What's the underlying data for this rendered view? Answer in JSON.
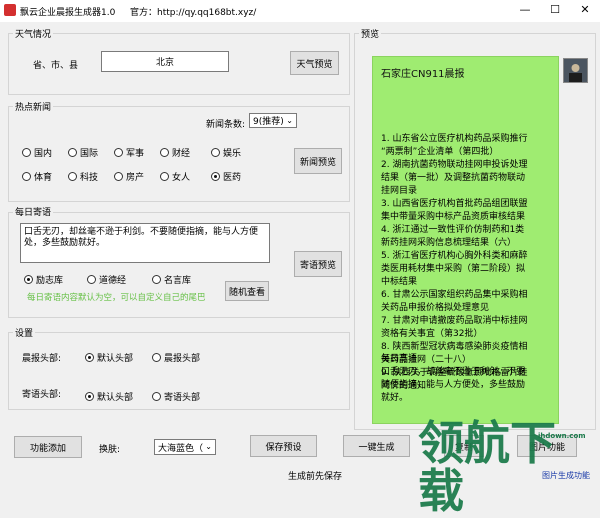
{
  "window": {
    "title": "飘云企业晨报生成器1.0",
    "website": "官方：http://qy.qq168bt.xyz/",
    "controls": [
      "—",
      "☐",
      "✕"
    ]
  },
  "weather": {
    "group_title": "天气情况",
    "label": "省、市、县",
    "value": "北京",
    "preview_button": "天气预览"
  },
  "news": {
    "group_title": "热点新闻",
    "count_label": "新闻条数:",
    "count_value": "9(推荐)",
    "categories": [
      {
        "label": "国内",
        "checked": false
      },
      {
        "label": "国际",
        "checked": false
      },
      {
        "label": "军事",
        "checked": false
      },
      {
        "label": "财经",
        "checked": false
      },
      {
        "label": "娱乐",
        "checked": false
      },
      {
        "label": "体育",
        "checked": false
      },
      {
        "label": "科技",
        "checked": false
      },
      {
        "label": "房产",
        "checked": false
      },
      {
        "label": "女人",
        "checked": false
      },
      {
        "label": "医药",
        "checked": true
      }
    ],
    "preview_button": "新闻预览"
  },
  "daily": {
    "group_title": "每日寄语",
    "text": "口舌无刃，却丝毫不逊于利剑。不要随便指摘，能与人方便处，多些鼓励就好。",
    "sources": [
      {
        "label": "励志库",
        "checked": true
      },
      {
        "label": "道德经",
        "checked": false
      },
      {
        "label": "名言库",
        "checked": false
      }
    ],
    "hint": "每日寄语内容默认为空，可以自定义自己的尾巴",
    "random_button": "随机查看",
    "preview_button": "寄语预览"
  },
  "settings": {
    "group_title": "设置",
    "rows": [
      {
        "label": "晨报头部:",
        "options": [
          {
            "label": "默认头部",
            "checked": true
          },
          {
            "label": "晨报头部",
            "checked": false
          }
        ]
      },
      {
        "label": "寄语头部:",
        "options": [
          {
            "label": "默认头部",
            "checked": true
          },
          {
            "label": "寄语头部",
            "checked": false
          }
        ]
      }
    ]
  },
  "footer": {
    "add_button": "功能添加",
    "skin_label": "换肤:",
    "skin_value": "大海蓝色（",
    "save_button": "保存预设",
    "generate_button": "一键生成",
    "copy_button": "复制",
    "image_button": "图片功能",
    "status": "生成前先保存",
    "image_status": "图片生成功能"
  },
  "preview": {
    "group_title": "预览",
    "heading": "石家庄CN911晨报",
    "news_lines": [
      "1. 山东省公立医疗机构药品采购推行",
      "“两票制”企业清单（第四批）",
      "2. 湖南抗菌药物联动挂网申投诉处理",
      "结果（第一批）及调整抗菌药物联动",
      "挂网目录",
      "3. 山西省医疗机构首批药品组团联盟",
      "集中带量采购中标产品资质审核结果",
      "4. 浙江通过一致性评价仿制药和1类",
      "新药挂网采购信息梳理结果（六）",
      "5. 浙江省医疗机构心胸外科类和麻醉",
      "类医用耗材集中采购（第二阶段）拟",
      "中标结果",
      "6. 甘肃公示国家组织药品集中采购相",
      "关药品申报价格拟处理意见",
      "7. 甘肃对申请撤废药品取消中标挂网",
      "资格有关事宜（第32批）",
      "8. 陕西新型冠状病毒感染肺炎疫情相",
      "关药品挂网（二十八）",
      "9. 陕西关于调整硫酸氢氯吡格雷片挂",
      "网价的通知"
    ],
    "daily_lines": [
      "每日寄语",
      "口舌无刃，却丝毫不逊于利剑。不要",
      "随便指摘，能与人方便处，多些鼓励",
      "就好。"
    ]
  },
  "watermark": {
    "text": "领航下载",
    "site": "ihdown.com"
  }
}
